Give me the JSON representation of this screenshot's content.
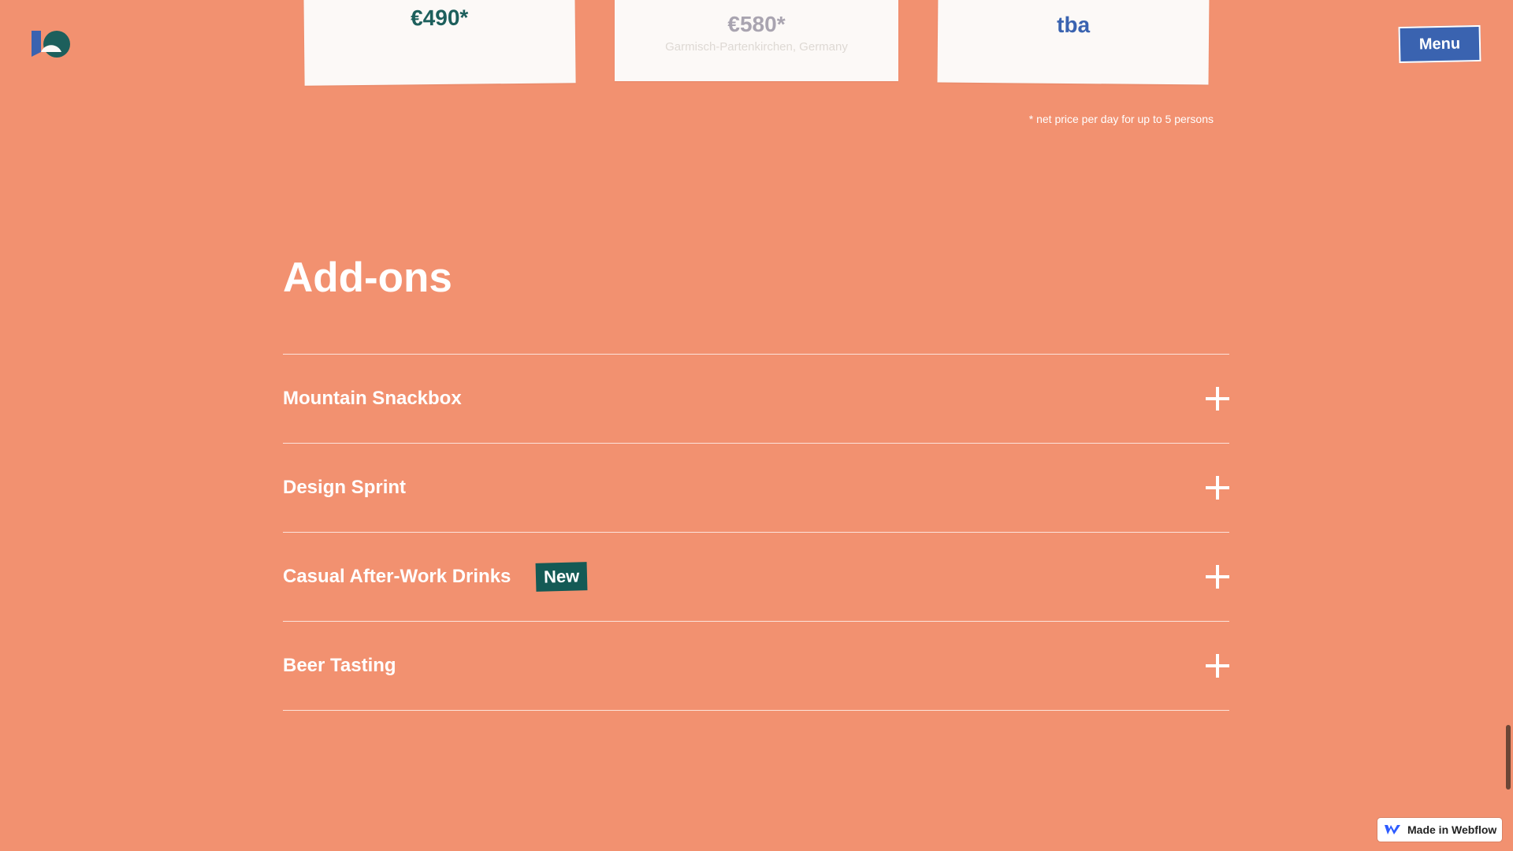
{
  "header": {
    "logo_icon": "studio-logo-icon",
    "menu_label": "Menu"
  },
  "pricing": {
    "cards": [
      {
        "price": "€490*"
      },
      {
        "price": "€580*",
        "location": "Garmisch-Partenkirchen, Germany"
      },
      {
        "price": "tba"
      }
    ],
    "footnote": "* net price per day for up to 5 persons"
  },
  "addons": {
    "title": "Add-ons",
    "items": [
      {
        "label": "Mountain Snackbox"
      },
      {
        "label": "Design Sprint"
      },
      {
        "label": "Casual After-Work Drinks",
        "badge": "New"
      },
      {
        "label": "Beer Tasting"
      }
    ],
    "expand_icon": "plus-icon"
  },
  "badge": {
    "label": "Made in Webflow",
    "icon": "webflow-icon"
  },
  "colors": {
    "background": "#f29170",
    "menu_button": "#3a63b0",
    "badge_new": "#145a55",
    "card": "#fcf9f7",
    "price_green": "#1d5f5c",
    "price_blue": "#3a63b0"
  }
}
